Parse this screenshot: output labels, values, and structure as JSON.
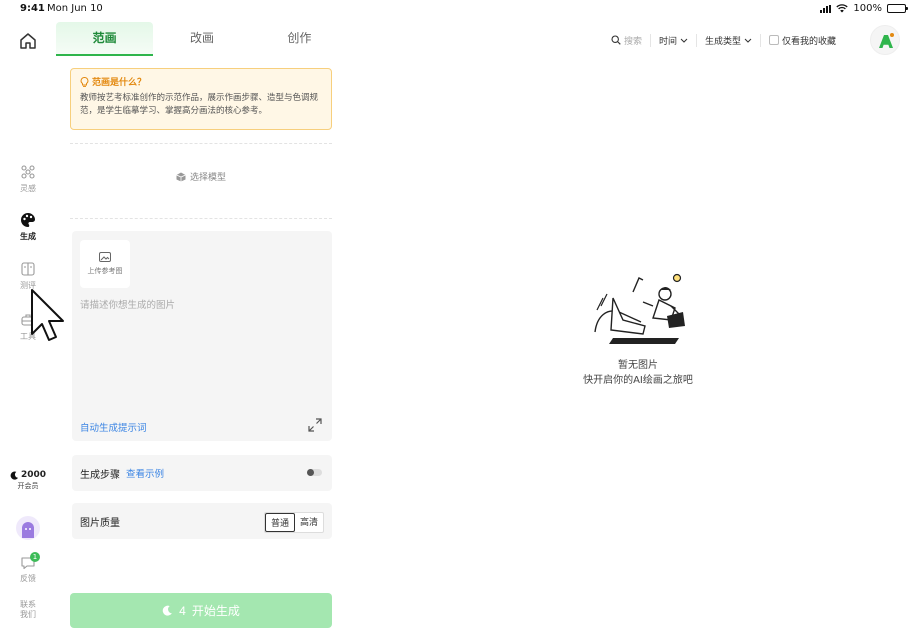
{
  "status_bar": {
    "time": "9:41",
    "date": "Mon Jun 10",
    "battery": "100%"
  },
  "sidebar": {
    "items": [
      {
        "label": "灵感",
        "icon": "inspiration-icon"
      },
      {
        "label": "生成",
        "icon": "palette-icon",
        "active": true
      },
      {
        "label": "测评",
        "icon": "evaluate-icon"
      },
      {
        "label": "工具",
        "icon": "tools-icon"
      }
    ],
    "credits": {
      "value": "2000",
      "label": "开会员"
    },
    "message": {
      "label": "反馈",
      "badge": "1"
    },
    "contact": {
      "line1": "联系",
      "line2": "我们"
    }
  },
  "tabs": [
    {
      "label": "范画",
      "active": true
    },
    {
      "label": "改画"
    },
    {
      "label": "创作"
    }
  ],
  "info": {
    "title": "范画是什么？",
    "text": "教师按艺考标准创作的示范作品，展示作画步骤、造型与色调规范，是学生临摹学习、掌握高分画法的核心参考。"
  },
  "model_select": {
    "label": "选择模型"
  },
  "prompt": {
    "upload_label": "上传参考图",
    "placeholder": "请描述你想生成的图片",
    "auto_generate": "自动生成提示词"
  },
  "steps": {
    "label": "生成步骤",
    "link": "查看示例"
  },
  "quality": {
    "label": "图片质量",
    "options": [
      "普通",
      "高清"
    ],
    "selected": "普通"
  },
  "start_button": {
    "cost": "4",
    "label": "开始生成"
  },
  "filters": {
    "search_placeholder": "搜索",
    "time": "时间",
    "type": "生成类型",
    "favorites": "仅看我的收藏"
  },
  "empty_state": {
    "line1": "暂无图片",
    "line2": "快开启你的AI绘画之旅吧"
  },
  "colors": {
    "accent": "#2fb54c",
    "link": "#3a84e3",
    "warning": "#e38a12",
    "start_button": "#a4e7b0"
  }
}
